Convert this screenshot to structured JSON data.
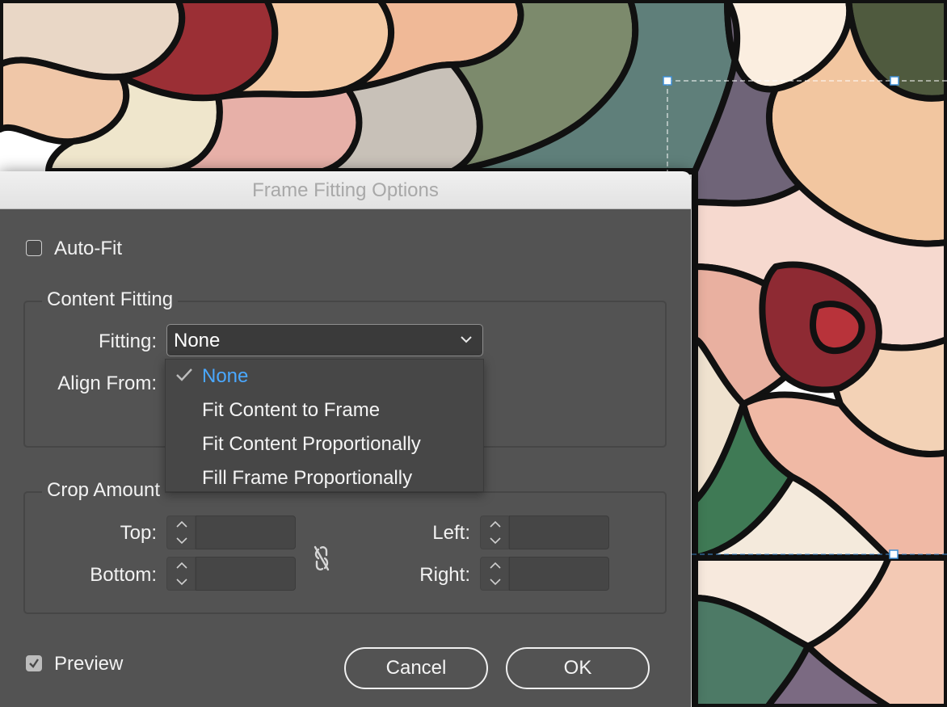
{
  "dialog": {
    "title": "Frame Fitting Options",
    "auto_fit_label": "Auto-Fit",
    "auto_fit_checked": false,
    "content_fitting": {
      "title": "Content Fitting",
      "fitting_label": "Fitting:",
      "fitting_value": "None",
      "align_from_label": "Align From:",
      "options": [
        {
          "label": "None",
          "selected": true
        },
        {
          "label": "Fit Content to Frame",
          "selected": false
        },
        {
          "label": "Fit Content Proportionally",
          "selected": false
        },
        {
          "label": "Fill Frame Proportionally",
          "selected": false
        }
      ]
    },
    "crop": {
      "title": "Crop Amount",
      "top_label": "Top:",
      "bottom_label": "Bottom:",
      "left_label": "Left:",
      "right_label": "Right:",
      "top_value": "",
      "bottom_value": "",
      "left_value": "",
      "right_value": ""
    },
    "preview_label": "Preview",
    "preview_checked": true,
    "cancel_label": "Cancel",
    "ok_label": "OK"
  },
  "colors": {
    "dialog_bg": "#535353",
    "selected_option": "#4aa8ff"
  },
  "icons": [
    "checkmark-icon",
    "chevron-down-icon",
    "stepper-arrows-icon",
    "chain-unlinked-icon"
  ]
}
